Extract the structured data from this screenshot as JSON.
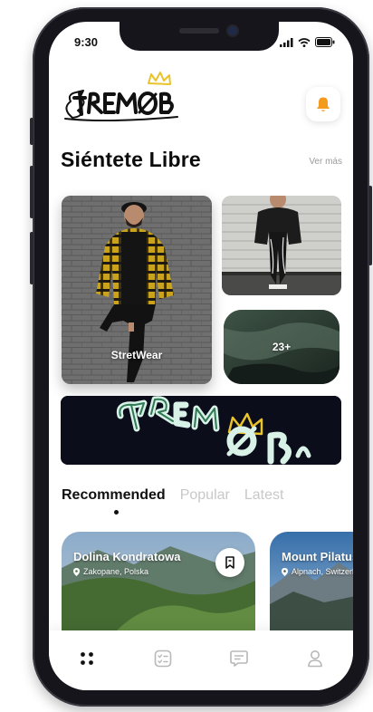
{
  "status_bar": {
    "time": "9:30"
  },
  "brand": {
    "logo_icon": "fremob-graffiti-logo-with-crown",
    "accent": "#e8c32a"
  },
  "header": {
    "notification_icon": "bell-icon",
    "notification_color": "#f39a1f"
  },
  "section": {
    "title": "Siéntete Libre",
    "see_more": "Ver más"
  },
  "gallery": {
    "main_card_label": "StretWear",
    "count_card_label": "23+"
  },
  "tabs": [
    {
      "label": "Recommended",
      "active": true
    },
    {
      "label": "Popular",
      "active": false
    },
    {
      "label": "Latest",
      "active": false
    }
  ],
  "destinations": [
    {
      "title": "Dolina Kondratowa",
      "location": "Zakopane, Polska"
    },
    {
      "title": "Mount Pilatus",
      "location": "Alpnach, Switzerland"
    }
  ],
  "bottom_nav": [
    {
      "icon": "grid-dots-icon",
      "active": true
    },
    {
      "icon": "checklist-icon",
      "active": false
    },
    {
      "icon": "chat-icon",
      "active": false
    },
    {
      "icon": "profile-icon",
      "active": false
    }
  ]
}
